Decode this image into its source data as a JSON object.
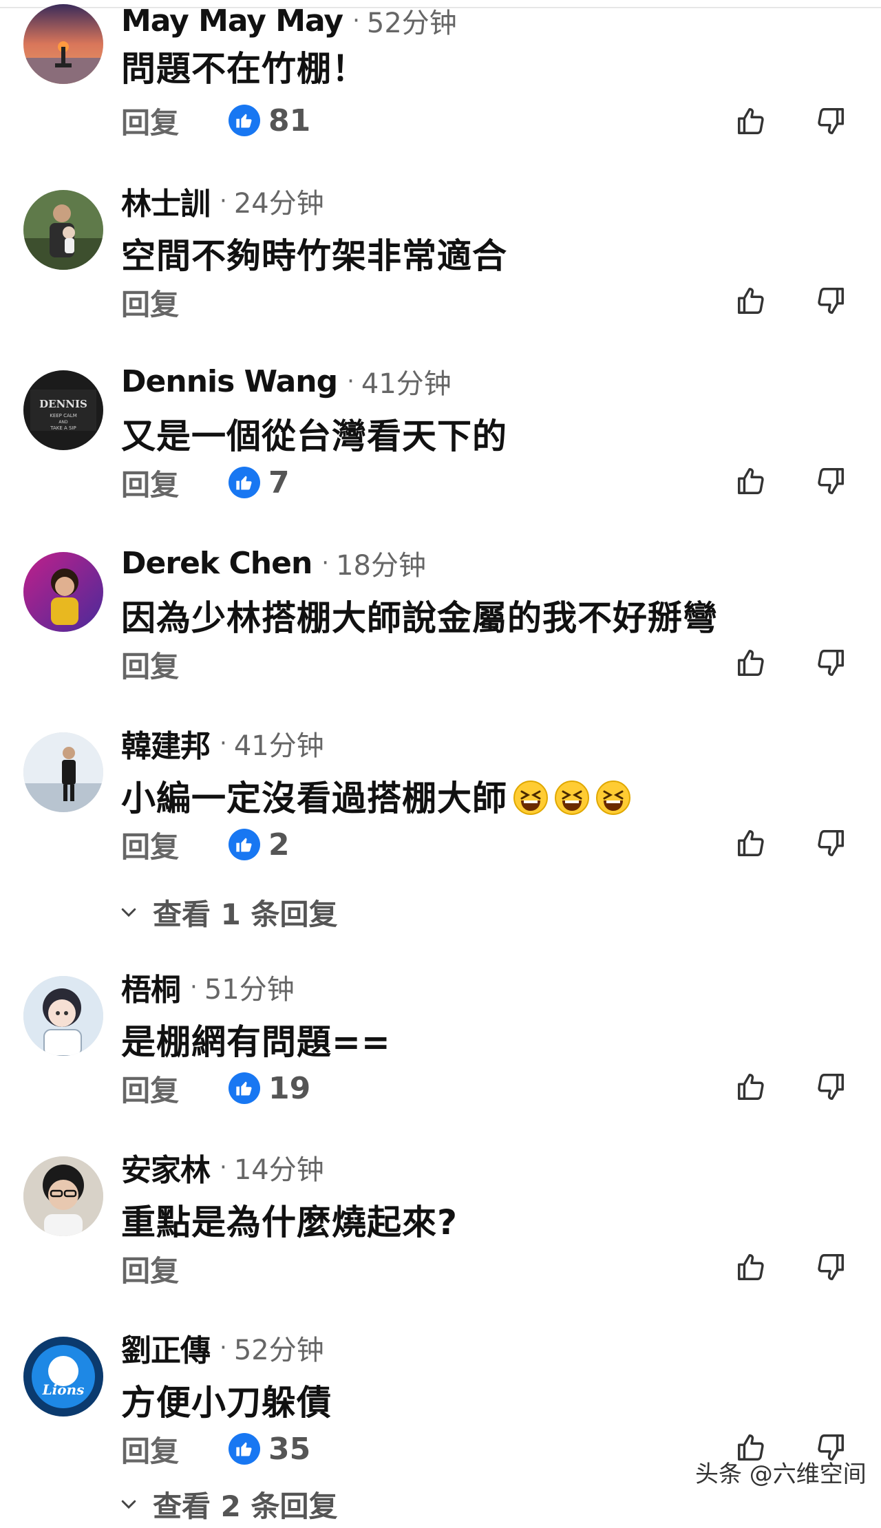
{
  "comments": [
    {
      "name": "May May May",
      "time": "52分钟",
      "text": "問題不在竹棚！",
      "reply": "回复",
      "reactions": "81"
    },
    {
      "name": "林士訓",
      "time": "24分钟",
      "text": "空間不夠時竹架非常適合",
      "reply": "回复",
      "reactions": ""
    },
    {
      "name": "Dennis Wang",
      "time": "41分钟",
      "text": "又是一個從台灣看天下的",
      "reply": "回复",
      "reactions": "7"
    },
    {
      "name": "Derek Chen",
      "time": "18分钟",
      "text": "因為少林搭棚大師說金屬的我不好掰彎",
      "reply": "回复",
      "reactions": ""
    },
    {
      "name": "韓建邦",
      "time": "41分钟",
      "text": "小編一定沒看過搭棚大師",
      "reply": "回复",
      "reactions": "2"
    },
    {
      "name": "梧桐",
      "time": "51分钟",
      "text": "是棚網有問題==",
      "reply": "回复",
      "reactions": "19"
    },
    {
      "name": "安家林",
      "time": "14分钟",
      "text": "重點是為什麼燒起來?",
      "reply": "回复",
      "reactions": ""
    },
    {
      "name": "劉正傳",
      "time": "52分钟",
      "text": "方便小刀躲債",
      "reply": "回复",
      "reactions": "35"
    }
  ],
  "view_replies": {
    "label": "查看 1 条回复"
  },
  "view_replies_2": {
    "label": "查看 2 条回复"
  },
  "watermark": {
    "text": "头条 @六维空间"
  },
  "dennis_avatar": {
    "title": "DENNIS",
    "line1": "KEEP CALM",
    "line2": "AND",
    "line3": "TAKE A SIP"
  },
  "lions_avatar": {
    "text": "Lions"
  },
  "colors": {
    "reaction_blue": "#1877f2",
    "secondary_text": "#666666"
  }
}
